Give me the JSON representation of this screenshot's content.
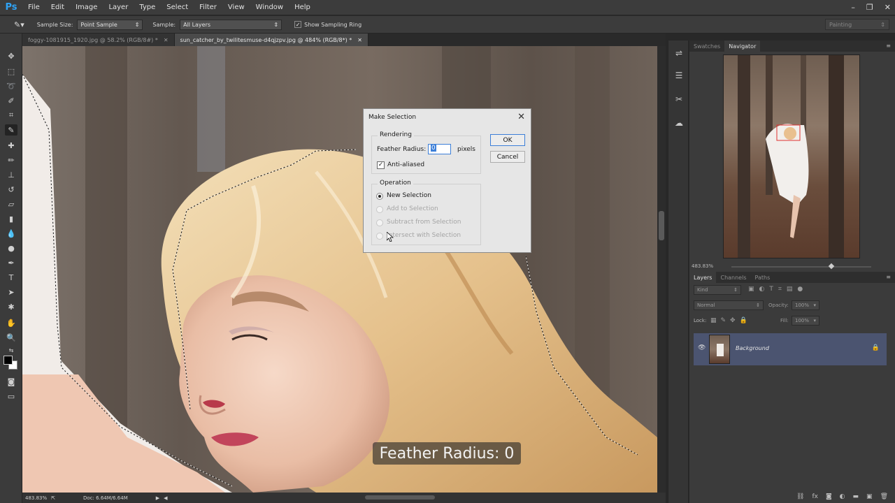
{
  "app": {
    "logo": "Ps"
  },
  "menu": [
    "File",
    "Edit",
    "Image",
    "Layer",
    "Type",
    "Select",
    "Filter",
    "View",
    "Window",
    "Help"
  ],
  "window_controls": {
    "minimize": "–",
    "restore": "❐",
    "close": "✕"
  },
  "options": {
    "sample_size_label": "Sample Size:",
    "sample_size_value": "Point Sample",
    "sample_label": "Sample:",
    "sample_value": "All Layers",
    "show_ring_label": "Show Sampling Ring",
    "show_ring_checked": true,
    "workspace": "Painting"
  },
  "tabs": [
    {
      "label": "foggy-1081915_1920.jpg @ 58.2% (RGB/8#) *",
      "active": false
    },
    {
      "label": "sun_catcher_by_twilitesmuse-d4qjzpv.jpg @ 484% (RGB/8*) *",
      "active": true
    }
  ],
  "status": {
    "zoom": "483.83%",
    "doc": "Doc: 6.64M/6.64M"
  },
  "overlay_caption": "Feather Radius: 0",
  "dialog": {
    "title": "Make Selection",
    "rendering_title": "Rendering",
    "feather_label": "Feather Radius:",
    "feather_value": "0",
    "feather_unit": "pixels",
    "antialias_label": "Anti-aliased",
    "antialias_checked": true,
    "operation_title": "Operation",
    "operations": [
      {
        "label": "New Selection",
        "selected": true,
        "enabled": true
      },
      {
        "label": "Add to Selection",
        "selected": false,
        "enabled": false
      },
      {
        "label": "Subtract from Selection",
        "selected": false,
        "enabled": false
      },
      {
        "label": "Intersect with Selection",
        "selected": false,
        "enabled": false
      }
    ],
    "ok_label": "OK",
    "cancel_label": "Cancel"
  },
  "navigator": {
    "tabs": [
      "Swatches",
      "Navigator"
    ],
    "active_tab": "Navigator",
    "zoom": "483.83%"
  },
  "layers": {
    "tabs": [
      "Layers",
      "Channels",
      "Paths"
    ],
    "active_tab": "Layers",
    "filter_kind": "Kind",
    "blend_mode": "Normal",
    "opacity_label": "Opacity:",
    "opacity_value": "100%",
    "lock_label": "Lock:",
    "fill_label": "Fill:",
    "fill_value": "100%",
    "items": [
      {
        "name": "Background",
        "visible": true,
        "locked": true
      }
    ]
  }
}
